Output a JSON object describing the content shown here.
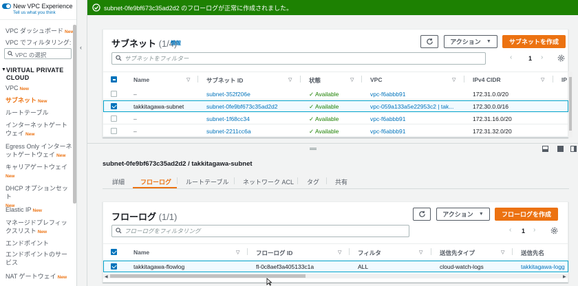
{
  "sidebar": {
    "experience_label": "New VPC Experience",
    "feedback_link": "Tell us what you think",
    "dashboard": "VPC ダッシュボード",
    "filter_label": "VPC でフィルタリング:",
    "vpc_select_placeholder": "VPC の選択",
    "section": "VIRTUAL PRIVATE CLOUD",
    "new_badge": "New",
    "items": [
      {
        "label": "VPC"
      },
      {
        "label": "サブネット"
      },
      {
        "label": "ルートテーブル"
      },
      {
        "label": "インターネットゲートウェイ"
      },
      {
        "label": "Egress Only インターネットゲートウェイ"
      },
      {
        "label": "キャリアゲートウェイ"
      },
      {
        "label": "DHCP オプションセット"
      },
      {
        "label": "Elastic IP"
      },
      {
        "label": "マネージドプレフィックスリスト"
      },
      {
        "label": "エンドポイント"
      },
      {
        "label": "エンドポイントのサービス"
      },
      {
        "label": "NAT ゲートウェイ"
      }
    ]
  },
  "flash": {
    "message": "subnet-0fe9bf673c35ad2d2 のフローログが正常に作成されました。"
  },
  "subnets": {
    "title": "サブネット",
    "count": "(1/4)",
    "info": "情報",
    "actions_label": "アクション",
    "create_label": "サブネットを作成",
    "filter_placeholder": "サブネットをフィルター",
    "page": "1",
    "columns": [
      "Name",
      "サブネット ID",
      "状態",
      "VPC",
      "IPv4 CIDR",
      "IP"
    ],
    "rows": [
      {
        "name": "–",
        "id": "subnet-352f206e",
        "state": "Available",
        "vpc": "vpc-f6abbb91",
        "cidr": "172.31.0.0/20",
        "selected": false
      },
      {
        "name": "takkitagawa-subnet",
        "id": "subnet-0fe9bf673c35ad2d2",
        "state": "Available",
        "vpc": "vpc-059a133a5e22953c2 | tak...",
        "cidr": "172.30.0.0/16",
        "selected": true
      },
      {
        "name": "–",
        "id": "subnet-1f68cc34",
        "state": "Available",
        "vpc": "vpc-f6abbb91",
        "cidr": "172.31.16.0/20",
        "selected": false
      },
      {
        "name": "–",
        "id": "subnet-2211cc6a",
        "state": "Available",
        "vpc": "vpc-f6abbb91",
        "cidr": "172.31.32.0/20",
        "selected": false
      }
    ]
  },
  "detail": {
    "title": "subnet-0fe9bf673c35ad2d2 / takkitagawa-subnet",
    "tabs": [
      "詳細",
      "フローログ",
      "ルートテーブル",
      "ネットワーク ACL",
      "タグ",
      "共有"
    ],
    "active_tab": 1
  },
  "flowlogs": {
    "title": "フローログ",
    "count": "(1/1)",
    "actions_label": "アクション",
    "create_label": "フローログを作成",
    "filter_placeholder": "フローログをフィルタリング",
    "page": "1",
    "columns": [
      "Name",
      "フローログ ID",
      "フィルタ",
      "送信先タイプ",
      "送信先名"
    ],
    "rows": [
      {
        "name": "takkitagawa-flowlog",
        "id": "fl-0c8aef3a405133c1a",
        "filter": "ALL",
        "dest_type": "cloud-watch-logs",
        "dest_name": "takkitagawa-logg"
      }
    ]
  },
  "colors": {
    "accent": "#ec7211",
    "link": "#0073bb",
    "success": "#1d8102",
    "selected_border": "#00a1c9"
  }
}
